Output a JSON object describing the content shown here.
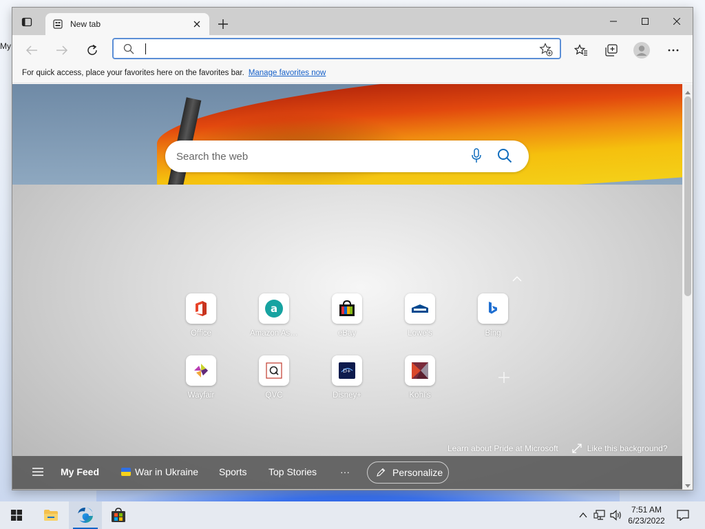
{
  "desktop": {
    "label": "My"
  },
  "browser": {
    "tab": {
      "title": "New tab"
    },
    "address": {
      "value": "",
      "placeholder": ""
    },
    "favorites_bar": {
      "message": "For quick access, place your favorites here on the favorites bar.",
      "link": "Manage favorites now"
    }
  },
  "newtab": {
    "search_placeholder": "Search the web",
    "tiles": [
      {
        "label": "Office",
        "icon": "office-icon"
      },
      {
        "label": "Amazon Assi...",
        "icon": "amazon-icon"
      },
      {
        "label": "eBay",
        "icon": "ebay-icon"
      },
      {
        "label": "Lowe's",
        "icon": "lowes-icon"
      },
      {
        "label": "Bing",
        "icon": "bing-icon"
      },
      {
        "label": "Wayfair",
        "icon": "wayfair-icon"
      },
      {
        "label": "QVC",
        "icon": "qvc-icon"
      },
      {
        "label": "Disney+",
        "icon": "disney-icon"
      },
      {
        "label": "Kohl's",
        "icon": "kohls-icon"
      }
    ],
    "pride_link": "Learn about Pride at Microsoft",
    "like_bg": "Like this background?",
    "feed": {
      "my_feed": "My Feed",
      "war": "War in Ukraine",
      "sports": "Sports",
      "top_stories": "Top Stories",
      "more": "···",
      "personalize": "Personalize"
    }
  },
  "taskbar": {
    "time": "7:51 AM",
    "date": "6/23/2022"
  },
  "colors": {
    "accent": "#0a64c8",
    "address_border": "#5b8ed6",
    "link": "#1560c9"
  }
}
